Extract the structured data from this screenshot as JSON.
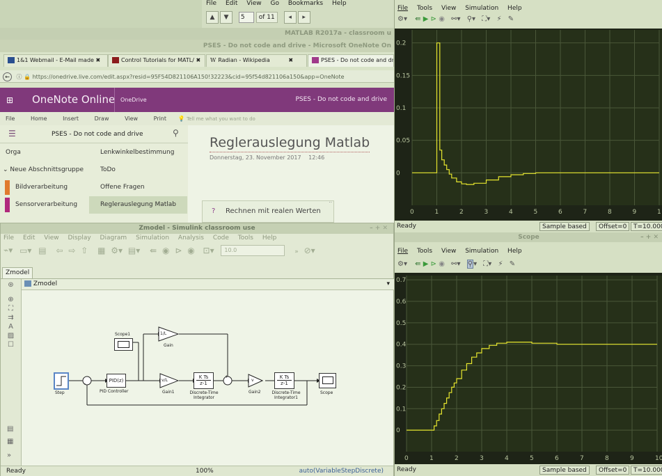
{
  "pdf_toolbar": {
    "menu": [
      "File",
      "Edit",
      "View",
      "Go",
      "Bookmarks",
      "Help"
    ],
    "page_value": "5",
    "page_total": "of 11"
  },
  "matlab_bar": {
    "title": "MATLAB R2017a - classroom u"
  },
  "browser": {
    "window_title": "PSES - Do not code and drive - Microsoft OneNote On",
    "tabs": [
      {
        "label": "1&1 Webmail - E-Mail made",
        "icon_color": "#2a4f8f"
      },
      {
        "label": "Control Tutorials for MATL/",
        "icon_color": "#8b1c1c"
      },
      {
        "label": "Radian - Wikipedia",
        "icon_color": "#555555"
      },
      {
        "label": "PSES - Do not code and dri",
        "icon_color": "#a03a8a"
      }
    ],
    "url": "https://onedrive.live.com/edit.aspx?resid=95F54D821106A150!32223&cid=95f54d821106a150&app=OneNote"
  },
  "onenote": {
    "app_name": "OneNote Online",
    "onedrive_link": "OneDrive",
    "notebook_title": "PSES - Do not code and drive",
    "ribbon": [
      "File",
      "Home",
      "Insert",
      "Draw",
      "View",
      "Print"
    ],
    "tell_me": "Tell me what you want to do",
    "sidebar_title": "PSES - Do not code and drive",
    "sections": [
      {
        "label": "Orga",
        "color": ""
      },
      {
        "label": "Neue Abschnittsgruppe",
        "color": ""
      },
      {
        "label": "Bildverarbeitung",
        "color": "#e07a2e"
      },
      {
        "label": "Sensorverarbeitung",
        "color": "#b0297c"
      }
    ],
    "pages": [
      "Lenkwinkelbestimmung",
      "ToDo",
      "Offene Fragen",
      "Reglerauslegung Matlab"
    ],
    "page_title": "Reglerauslegung Matlab",
    "page_date": "Donnerstag, 23. November 2017",
    "page_time": "12:46",
    "note_line": "Rechnen mit realen Werten"
  },
  "simulink": {
    "title": "Zmodel - Simulink classroom use",
    "menu": [
      "File",
      "Edit",
      "View",
      "Display",
      "Diagram",
      "Simulation",
      "Analysis",
      "Code",
      "Tools",
      "Help"
    ],
    "stop_time": "10.0",
    "tab": "Zmodel",
    "breadcrumb": "Zmodel",
    "blocks": {
      "step": "Step",
      "pid": "PID(z)",
      "pid_label": "PID Controller",
      "scope1": "Scope1",
      "gain_top": "1/L",
      "gain_top_label": "Gain",
      "gain1": "v/L",
      "gain1_label": "Gain1",
      "int1_num": "K Ts",
      "int1_den": "z-1",
      "int1_label": "Discrete-Time Integrator",
      "gain2": "v",
      "gain2_label": "Gain2",
      "int2_num": "K Ts",
      "int2_den": "z-1",
      "int2_label": "Discrete-Time Integrator1",
      "scope": "Scope"
    },
    "status_ready": "Ready",
    "status_zoom": "100%",
    "status_solver": "auto(VariableStepDiscrete)"
  },
  "scope_top": {
    "menu": [
      "File",
      "Tools",
      "View",
      "Simulation",
      "Help"
    ],
    "status": [
      "Ready",
      "Sample based",
      "Offset=0",
      "T=10.000"
    ],
    "y_ticks": [
      "0.2",
      "0.15",
      "0.1",
      "0.05",
      "0"
    ],
    "x_ticks": [
      "0",
      "1",
      "2",
      "3",
      "4",
      "5",
      "6",
      "7",
      "8",
      "9",
      "1"
    ]
  },
  "scope_bottom": {
    "title": "Scope",
    "menu": [
      "File",
      "Tools",
      "View",
      "Simulation",
      "Help"
    ],
    "status": [
      "Ready",
      "Sample based",
      "Offset=0",
      "T=10.000"
    ],
    "y_ticks": [
      "0.7",
      "0.6",
      "0.5",
      "0.4",
      "0.3",
      "0.2",
      "0.1",
      "0"
    ],
    "x_ticks": [
      "0",
      "1",
      "2",
      "3",
      "4",
      "5",
      "6",
      "7",
      "8",
      "9",
      "10"
    ]
  },
  "chart_data": [
    {
      "type": "line",
      "series": [
        {
          "values_x": [
            0,
            0.99,
            1.0,
            1.1,
            1.12,
            1.2,
            1.3,
            1.4,
            1.5,
            1.6,
            1.8,
            2.0,
            2.2,
            2.5,
            3.0,
            3.5,
            4.0,
            4.5,
            5.0,
            6.0,
            7.0,
            8.0,
            9.0,
            10.0
          ],
          "values": [
            0,
            0,
            0.2,
            0.2,
            0.035,
            0.02,
            0.012,
            0.005,
            -0.002,
            -0.008,
            -0.014,
            -0.017,
            -0.018,
            -0.016,
            -0.011,
            -0.006,
            -0.003,
            -0.001,
            0,
            0,
            0,
            0,
            0,
            0
          ]
        }
      ],
      "ylim": [
        -0.05,
        0.22
      ],
      "xlim": [
        0,
        10
      ],
      "color": "#e6e62e"
    },
    {
      "type": "line",
      "series": [
        {
          "values_x": [
            0,
            1.0,
            1.1,
            1.2,
            1.3,
            1.4,
            1.5,
            1.6,
            1.7,
            1.8,
            1.9,
            2.0,
            2.2,
            2.4,
            2.6,
            2.8,
            3.0,
            3.3,
            3.6,
            4.0,
            4.5,
            5.0,
            6.0,
            7.0,
            8.0,
            9.0,
            10.0
          ],
          "values": [
            0,
            0,
            0.02,
            0.045,
            0.075,
            0.1,
            0.125,
            0.15,
            0.175,
            0.2,
            0.22,
            0.24,
            0.28,
            0.31,
            0.34,
            0.36,
            0.38,
            0.395,
            0.405,
            0.41,
            0.41,
            0.405,
            0.4,
            0.4,
            0.4,
            0.4,
            0.4
          ]
        }
      ],
      "ylim": [
        -0.1,
        0.72
      ],
      "xlim": [
        0,
        10
      ],
      "color": "#e6e62e"
    }
  ]
}
